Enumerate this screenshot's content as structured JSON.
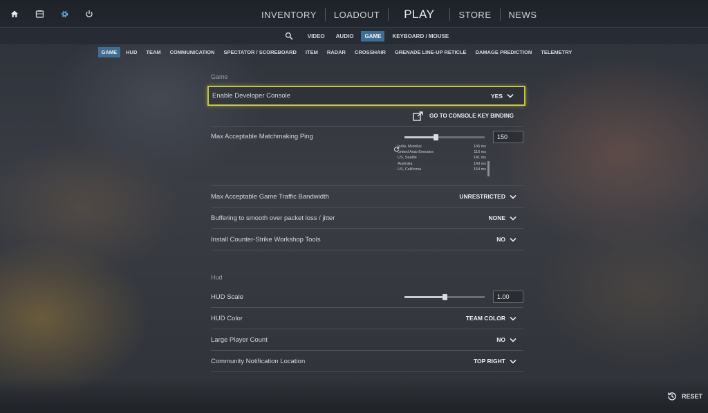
{
  "top_icons": [
    "home-icon",
    "inventory-box-icon",
    "gear-icon",
    "power-icon"
  ],
  "main_nav": {
    "inventory": "INVENTORY",
    "loadout": "LOADOUT",
    "play": "PLAY",
    "store": "STORE",
    "news": "NEWS"
  },
  "settings_tabs": {
    "video": "VIDEO",
    "audio": "AUDIO",
    "game": "GAME",
    "keyboard": "KEYBOARD / MOUSE"
  },
  "category_tabs": {
    "game": "GAME",
    "hud": "HUD",
    "team": "TEAM",
    "communication": "COMMUNICATION",
    "spectator": "SPECTATOR / SCOREBOARD",
    "item": "ITEM",
    "radar": "RADAR",
    "crosshair": "CROSSHAIR",
    "grenade": "GRENADE LINE-UP RETICLE",
    "damage": "DAMAGE PREDICTION",
    "telemetry": "TELEMETRY"
  },
  "game_section": {
    "title": "Game",
    "developer_console": {
      "label": "Enable Developer Console",
      "value": "YES"
    },
    "console_link": "GO TO CONSOLE KEY BINDING",
    "ping": {
      "label": "Max Acceptable Matchmaking Ping",
      "value": "150",
      "slider_fraction": 0.39
    },
    "servers": [
      {
        "name": "India, Mumbai",
        "ping": "105 ms"
      },
      {
        "name": "United Arab Emirates",
        "ping": "116 ms"
      },
      {
        "name": "US, Seattle",
        "ping": "141 ms"
      },
      {
        "name": "Australia",
        "ping": "143 ms"
      },
      {
        "name": "US, California",
        "ping": "154 ms"
      }
    ],
    "bandwidth": {
      "label": "Max Acceptable Game Traffic Bandwidth",
      "value": "UNRESTRICTED"
    },
    "buffering": {
      "label": "Buffering to smooth over packet loss / jitter",
      "value": "NONE"
    },
    "workshop": {
      "label": "Install Counter-Strike Workshop Tools",
      "value": "NO"
    }
  },
  "hud_section": {
    "title": "Hud",
    "scale": {
      "label": "HUD Scale",
      "value": "1.00",
      "slider_fraction": 0.5
    },
    "color": {
      "label": "HUD Color",
      "value": "TEAM COLOR"
    },
    "large_player_count": {
      "label": "Large Player Count",
      "value": "NO"
    },
    "notification_location": {
      "label": "Community Notification Location",
      "value": "TOP RIGHT"
    }
  },
  "reset_label": "RESET",
  "colors": {
    "accent": "#3e6f93",
    "highlight": "#c9c63f"
  }
}
